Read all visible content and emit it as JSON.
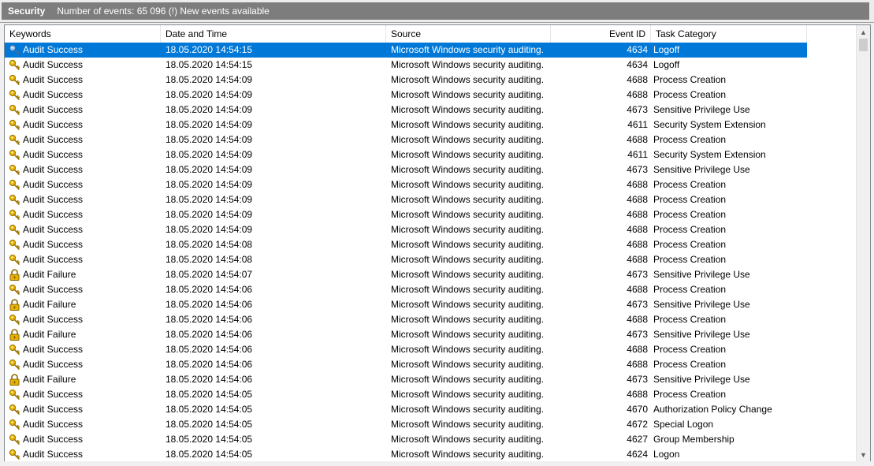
{
  "window": {
    "title": "Security",
    "info": "Number of events: 65 096 (!) New events available"
  },
  "columns": {
    "keywords": "Keywords",
    "datetime": "Date and Time",
    "source": "Source",
    "event_id": "Event ID",
    "task_category": "Task Category"
  },
  "icons": {
    "success": "key-icon",
    "failure": "padlock-icon"
  },
  "colors": {
    "selection": "#0078d7",
    "titlebar": "#7d7d7d",
    "key_gold": "#d9a300",
    "lock_gold": "#e0a800"
  },
  "rows": [
    {
      "keyword": "Audit Success",
      "type": "success",
      "datetime": "18.05.2020 14:54:15",
      "source": "Microsoft Windows security auditing.",
      "event_id": "4634",
      "category": "Logoff",
      "selected": true
    },
    {
      "keyword": "Audit Success",
      "type": "success",
      "datetime": "18.05.2020 14:54:15",
      "source": "Microsoft Windows security auditing.",
      "event_id": "4634",
      "category": "Logoff"
    },
    {
      "keyword": "Audit Success",
      "type": "success",
      "datetime": "18.05.2020 14:54:09",
      "source": "Microsoft Windows security auditing.",
      "event_id": "4688",
      "category": "Process Creation"
    },
    {
      "keyword": "Audit Success",
      "type": "success",
      "datetime": "18.05.2020 14:54:09",
      "source": "Microsoft Windows security auditing.",
      "event_id": "4688",
      "category": "Process Creation"
    },
    {
      "keyword": "Audit Success",
      "type": "success",
      "datetime": "18.05.2020 14:54:09",
      "source": "Microsoft Windows security auditing.",
      "event_id": "4673",
      "category": "Sensitive Privilege Use"
    },
    {
      "keyword": "Audit Success",
      "type": "success",
      "datetime": "18.05.2020 14:54:09",
      "source": "Microsoft Windows security auditing.",
      "event_id": "4611",
      "category": "Security System Extension"
    },
    {
      "keyword": "Audit Success",
      "type": "success",
      "datetime": "18.05.2020 14:54:09",
      "source": "Microsoft Windows security auditing.",
      "event_id": "4688",
      "category": "Process Creation"
    },
    {
      "keyword": "Audit Success",
      "type": "success",
      "datetime": "18.05.2020 14:54:09",
      "source": "Microsoft Windows security auditing.",
      "event_id": "4611",
      "category": "Security System Extension"
    },
    {
      "keyword": "Audit Success",
      "type": "success",
      "datetime": "18.05.2020 14:54:09",
      "source": "Microsoft Windows security auditing.",
      "event_id": "4673",
      "category": "Sensitive Privilege Use"
    },
    {
      "keyword": "Audit Success",
      "type": "success",
      "datetime": "18.05.2020 14:54:09",
      "source": "Microsoft Windows security auditing.",
      "event_id": "4688",
      "category": "Process Creation"
    },
    {
      "keyword": "Audit Success",
      "type": "success",
      "datetime": "18.05.2020 14:54:09",
      "source": "Microsoft Windows security auditing.",
      "event_id": "4688",
      "category": "Process Creation"
    },
    {
      "keyword": "Audit Success",
      "type": "success",
      "datetime": "18.05.2020 14:54:09",
      "source": "Microsoft Windows security auditing.",
      "event_id": "4688",
      "category": "Process Creation"
    },
    {
      "keyword": "Audit Success",
      "type": "success",
      "datetime": "18.05.2020 14:54:09",
      "source": "Microsoft Windows security auditing.",
      "event_id": "4688",
      "category": "Process Creation"
    },
    {
      "keyword": "Audit Success",
      "type": "success",
      "datetime": "18.05.2020 14:54:08",
      "source": "Microsoft Windows security auditing.",
      "event_id": "4688",
      "category": "Process Creation"
    },
    {
      "keyword": "Audit Success",
      "type": "success",
      "datetime": "18.05.2020 14:54:08",
      "source": "Microsoft Windows security auditing.",
      "event_id": "4688",
      "category": "Process Creation"
    },
    {
      "keyword": "Audit Failure",
      "type": "failure",
      "datetime": "18.05.2020 14:54:07",
      "source": "Microsoft Windows security auditing.",
      "event_id": "4673",
      "category": "Sensitive Privilege Use"
    },
    {
      "keyword": "Audit Success",
      "type": "success",
      "datetime": "18.05.2020 14:54:06",
      "source": "Microsoft Windows security auditing.",
      "event_id": "4688",
      "category": "Process Creation"
    },
    {
      "keyword": "Audit Failure",
      "type": "failure",
      "datetime": "18.05.2020 14:54:06",
      "source": "Microsoft Windows security auditing.",
      "event_id": "4673",
      "category": "Sensitive Privilege Use"
    },
    {
      "keyword": "Audit Success",
      "type": "success",
      "datetime": "18.05.2020 14:54:06",
      "source": "Microsoft Windows security auditing.",
      "event_id": "4688",
      "category": "Process Creation"
    },
    {
      "keyword": "Audit Failure",
      "type": "failure",
      "datetime": "18.05.2020 14:54:06",
      "source": "Microsoft Windows security auditing.",
      "event_id": "4673",
      "category": "Sensitive Privilege Use"
    },
    {
      "keyword": "Audit Success",
      "type": "success",
      "datetime": "18.05.2020 14:54:06",
      "source": "Microsoft Windows security auditing.",
      "event_id": "4688",
      "category": "Process Creation"
    },
    {
      "keyword": "Audit Success",
      "type": "success",
      "datetime": "18.05.2020 14:54:06",
      "source": "Microsoft Windows security auditing.",
      "event_id": "4688",
      "category": "Process Creation"
    },
    {
      "keyword": "Audit Failure",
      "type": "failure",
      "datetime": "18.05.2020 14:54:06",
      "source": "Microsoft Windows security auditing.",
      "event_id": "4673",
      "category": "Sensitive Privilege Use"
    },
    {
      "keyword": "Audit Success",
      "type": "success",
      "datetime": "18.05.2020 14:54:05",
      "source": "Microsoft Windows security auditing.",
      "event_id": "4688",
      "category": "Process Creation"
    },
    {
      "keyword": "Audit Success",
      "type": "success",
      "datetime": "18.05.2020 14:54:05",
      "source": "Microsoft Windows security auditing.",
      "event_id": "4670",
      "category": "Authorization Policy Change"
    },
    {
      "keyword": "Audit Success",
      "type": "success",
      "datetime": "18.05.2020 14:54:05",
      "source": "Microsoft Windows security auditing.",
      "event_id": "4672",
      "category": "Special Logon"
    },
    {
      "keyword": "Audit Success",
      "type": "success",
      "datetime": "18.05.2020 14:54:05",
      "source": "Microsoft Windows security auditing.",
      "event_id": "4627",
      "category": "Group Membership"
    },
    {
      "keyword": "Audit Success",
      "type": "success",
      "datetime": "18.05.2020 14:54:05",
      "source": "Microsoft Windows security auditing.",
      "event_id": "4624",
      "category": "Logon"
    }
  ]
}
